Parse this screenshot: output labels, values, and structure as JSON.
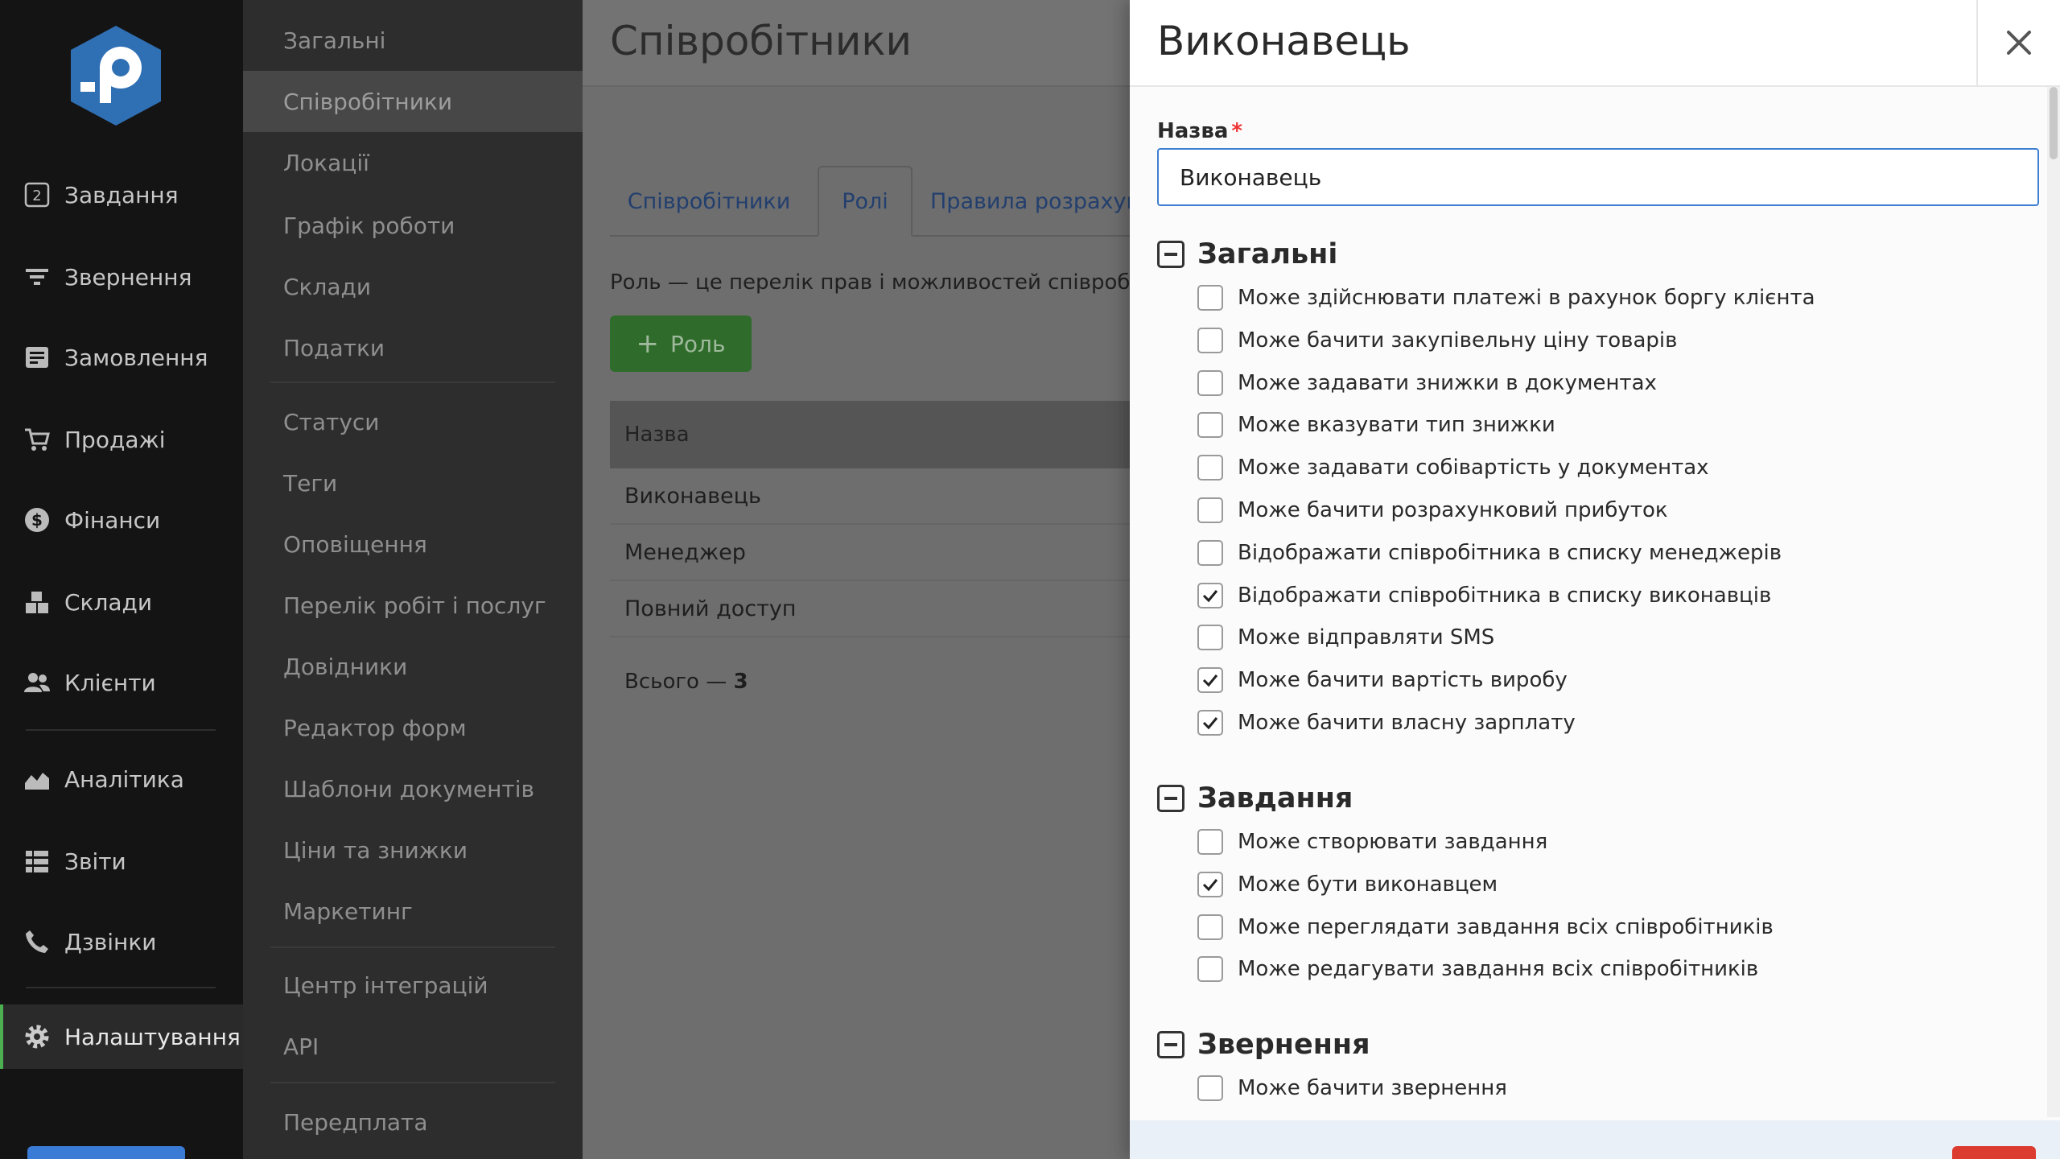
{
  "nav": {
    "items": [
      {
        "label": "Завдання",
        "icon": "badge-2-icon",
        "badge": "2"
      },
      {
        "label": "Звернення",
        "icon": "funnel-icon"
      },
      {
        "label": "Замовлення",
        "icon": "order-doc-icon"
      },
      {
        "label": "Продажі",
        "icon": "cart-icon"
      },
      {
        "label": "Фінанси",
        "icon": "dollar-circle-icon"
      },
      {
        "label": "Склади",
        "icon": "boxes-icon"
      },
      {
        "label": "Клієнти",
        "icon": "users-icon"
      },
      {
        "label": "Аналітика",
        "icon": "area-chart-icon"
      },
      {
        "label": "Звіти",
        "icon": "list-report-icon"
      },
      {
        "label": "Дзвінки",
        "icon": "phone-icon"
      },
      {
        "label": "Налаштування",
        "icon": "gear-icon",
        "active": true
      }
    ]
  },
  "settings_menu": {
    "items": [
      "Загальні",
      "Співробітники",
      "Локації",
      "Графік роботи",
      "Склади",
      "Податки",
      "Статуси",
      "Теги",
      "Оповіщення",
      "Перелік робіт і послуг",
      "Довідники",
      "Редактор форм",
      "Шаблони документів",
      "Ціни та знижки",
      "Маркетинг",
      "Центр інтеграцій",
      "API",
      "Передплата"
    ],
    "active": "Співробітники"
  },
  "main": {
    "title": "Співробітники",
    "tabs": [
      "Співробітники",
      "Ролі",
      "Правила розрахунку"
    ],
    "active_tab": "Ролі",
    "description": "Роль — це перелік прав і можливостей співробітника",
    "add_button": "Роль",
    "table_header": "Назва",
    "rows": [
      "Виконавець",
      "Менеджер",
      "Повний доступ"
    ],
    "total_label": "Всього — ",
    "total_value": "3"
  },
  "panel": {
    "title": "Виконавець",
    "name_label": "Назва",
    "required_mark": "*",
    "name_value": "Виконавець",
    "sections": [
      {
        "title": "Загальні",
        "permissions": [
          {
            "label": "Може здійснювати платежі в рахунок боргу клієнта",
            "checked": false
          },
          {
            "label": "Може бачити закупівельну ціну товарів",
            "checked": false
          },
          {
            "label": "Може задавати знижки в документах",
            "checked": false
          },
          {
            "label": "Може вказувати тип знижки",
            "checked": false
          },
          {
            "label": "Може задавати собівартість у документах",
            "checked": false
          },
          {
            "label": "Може бачити розрахунковий прибуток",
            "checked": false
          },
          {
            "label": "Відображати співробітника в списку менеджерів",
            "checked": false
          },
          {
            "label": "Відображати співробітника в списку виконавців",
            "checked": true
          },
          {
            "label": "Може відправляти SMS",
            "checked": false
          },
          {
            "label": "Може бачити вартість виробу",
            "checked": true
          },
          {
            "label": "Може бачити власну зарплату",
            "checked": true
          }
        ]
      },
      {
        "title": "Завдання",
        "permissions": [
          {
            "label": "Може створювати завдання",
            "checked": false
          },
          {
            "label": "Може бути виконавцем",
            "checked": true
          },
          {
            "label": "Може переглядати завдання всіх співробітників",
            "checked": false
          },
          {
            "label": "Може редагувати завдання всіх співробітників",
            "checked": false
          }
        ]
      },
      {
        "title": "Звернення",
        "permissions": [
          {
            "label": "Може бачити звернення",
            "checked": false
          }
        ]
      }
    ]
  },
  "colors": {
    "accent_green": "#4caf50",
    "primary_blue": "#3a7bd5",
    "danger_red": "#dc3b2f",
    "logo_blue": "#2f6fb4"
  }
}
